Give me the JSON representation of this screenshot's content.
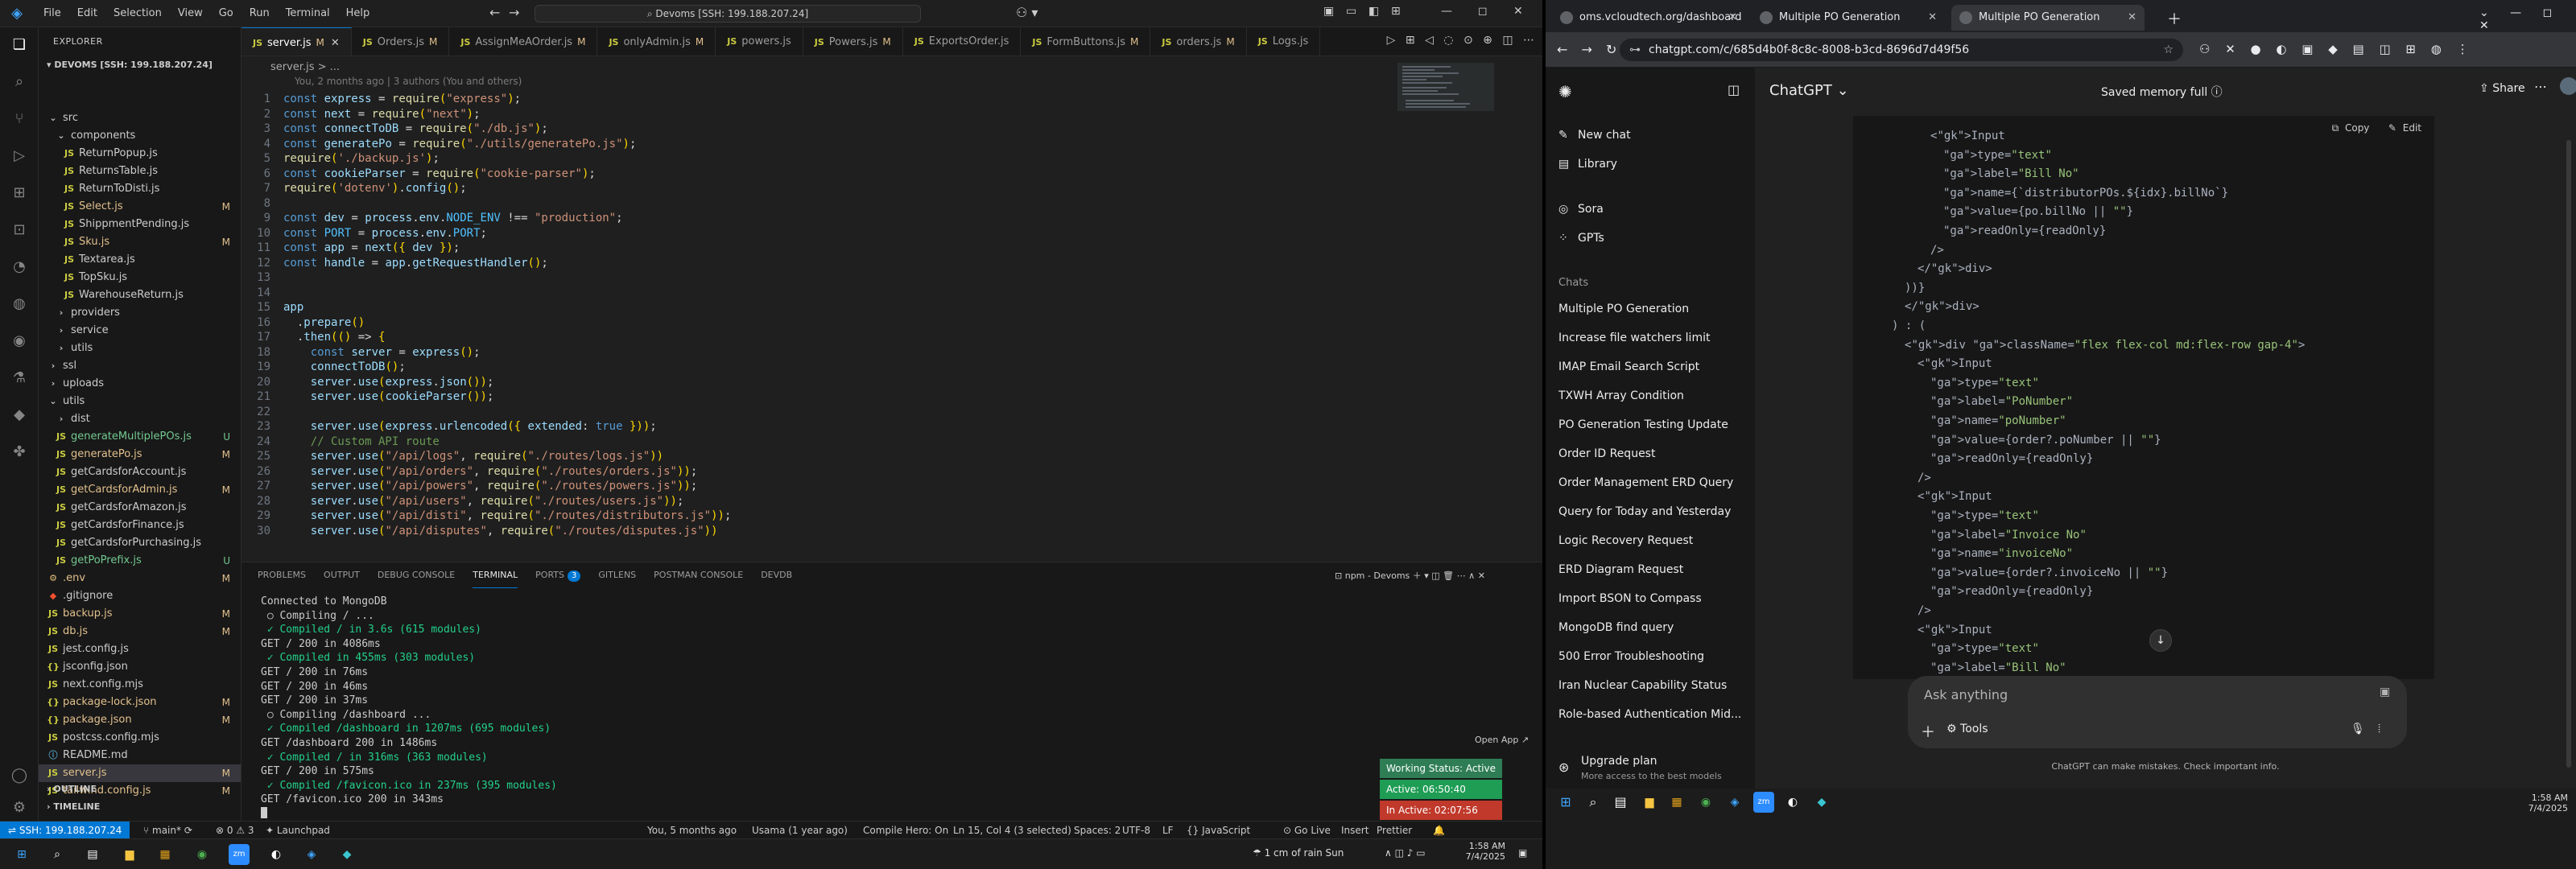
{
  "vscode": {
    "menu": [
      "File",
      "Edit",
      "Selection",
      "View",
      "Go",
      "Run",
      "Terminal",
      "Help"
    ],
    "search_text": "Devoms [SSH: 199.188.207.24]",
    "explorer_title": "EXPLORER",
    "workspace_title": "DEVOMS [SSH: 199.188.207.24]",
    "tree": [
      {
        "label": "src",
        "kind": "folder-open",
        "indent": 1,
        "badge": ""
      },
      {
        "label": "components",
        "kind": "folder-open",
        "indent": 2,
        "badge": ""
      },
      {
        "label": "ReturnPopup.js",
        "kind": "js",
        "indent": 3,
        "badge": ""
      },
      {
        "label": "ReturnsTable.js",
        "kind": "js",
        "indent": 3,
        "badge": ""
      },
      {
        "label": "ReturnToDisti.js",
        "kind": "js",
        "indent": 3,
        "badge": ""
      },
      {
        "label": "Select.js",
        "kind": "js",
        "indent": 3,
        "badge": "M"
      },
      {
        "label": "ShippmentPending.js",
        "kind": "js",
        "indent": 3,
        "badge": ""
      },
      {
        "label": "Sku.js",
        "kind": "js",
        "indent": 3,
        "badge": "M"
      },
      {
        "label": "Textarea.js",
        "kind": "js",
        "indent": 3,
        "badge": ""
      },
      {
        "label": "TopSku.js",
        "kind": "js",
        "indent": 3,
        "badge": ""
      },
      {
        "label": "WarehouseReturn.js",
        "kind": "js",
        "indent": 3,
        "badge": ""
      },
      {
        "label": "providers",
        "kind": "folder",
        "indent": 2,
        "badge": ""
      },
      {
        "label": "service",
        "kind": "folder",
        "indent": 2,
        "badge": ""
      },
      {
        "label": "utils",
        "kind": "folder",
        "indent": 2,
        "badge": ""
      },
      {
        "label": "ssl",
        "kind": "folder",
        "indent": 1,
        "badge": ""
      },
      {
        "label": "uploads",
        "kind": "folder",
        "indent": 1,
        "badge": ""
      },
      {
        "label": "utils",
        "kind": "folder-open",
        "indent": 1,
        "badge": ""
      },
      {
        "label": "dist",
        "kind": "folder",
        "indent": 2,
        "badge": ""
      },
      {
        "label": "generateMultiplePOs.js",
        "kind": "js",
        "indent": 2,
        "badge": "U"
      },
      {
        "label": "generatePo.js",
        "kind": "js",
        "indent": 2,
        "badge": "M"
      },
      {
        "label": "getCardsforAccount.js",
        "kind": "js",
        "indent": 2,
        "badge": ""
      },
      {
        "label": "getCardsforAdmin.js",
        "kind": "js",
        "indent": 2,
        "badge": "M"
      },
      {
        "label": "getCardsforAmazon.js",
        "kind": "js",
        "indent": 2,
        "badge": ""
      },
      {
        "label": "getCardsforFinance.js",
        "kind": "js",
        "indent": 2,
        "badge": ""
      },
      {
        "label": "getCardsforPurchasing.js",
        "kind": "js",
        "indent": 2,
        "badge": ""
      },
      {
        "label": "getPoPrefix.js",
        "kind": "js",
        "indent": 2,
        "badge": "U"
      },
      {
        "label": ".env",
        "kind": "env",
        "indent": 1,
        "badge": "M"
      },
      {
        "label": ".gitignore",
        "kind": "git",
        "indent": 1,
        "badge": ""
      },
      {
        "label": "backup.js",
        "kind": "js",
        "indent": 1,
        "badge": "M"
      },
      {
        "label": "db.js",
        "kind": "js",
        "indent": 1,
        "badge": "M"
      },
      {
        "label": "jest.config.js",
        "kind": "js",
        "indent": 1,
        "badge": ""
      },
      {
        "label": "jsconfig.json",
        "kind": "json",
        "indent": 1,
        "badge": ""
      },
      {
        "label": "next.config.mjs",
        "kind": "js",
        "indent": 1,
        "badge": ""
      },
      {
        "label": "package-lock.json",
        "kind": "json",
        "indent": 1,
        "badge": "M"
      },
      {
        "label": "package.json",
        "kind": "json",
        "indent": 1,
        "badge": "M"
      },
      {
        "label": "postcss.config.mjs",
        "kind": "js",
        "indent": 1,
        "badge": ""
      },
      {
        "label": "README.md",
        "kind": "md",
        "indent": 1,
        "badge": ""
      },
      {
        "label": "server.js",
        "kind": "js",
        "indent": 1,
        "badge": "M",
        "selected": true
      },
      {
        "label": "tailwind.config.js",
        "kind": "js",
        "indent": 1,
        "badge": "M"
      }
    ],
    "outline_label": "OUTLINE",
    "timeline_label": "TIMELINE",
    "tabs": [
      {
        "label": "server.js",
        "mod": "M",
        "active": true
      },
      {
        "label": "Orders.js",
        "mod": "M"
      },
      {
        "label": "AssignMeAOrder.js",
        "mod": "M"
      },
      {
        "label": "onlyAdmin.js",
        "mod": "M"
      },
      {
        "label": "powers.js",
        "mod": ""
      },
      {
        "label": "Powers.js",
        "mod": "M"
      },
      {
        "label": "ExportsOrder.js",
        "mod": ""
      },
      {
        "label": "FormButtons.js",
        "mod": "M"
      },
      {
        "label": "orders.js",
        "mod": "M"
      },
      {
        "label": "Logs.js",
        "mod": ""
      }
    ],
    "breadcrumb": "server.js > ...",
    "blame": "You, 2 months ago | 3 authors (You and others)",
    "code_lines": [
      "const express = require(\"express\");",
      "const next = require(\"next\");",
      "const connectToDB = require(\"./db.js\");",
      "const generatePo = require(\"./utils/generatePo.js\");",
      "require('./backup.js');",
      "const cookieParser = require(\"cookie-parser\");",
      "require('dotenv').config();",
      "",
      "const dev = process.env.NODE_ENV !== \"production\";",
      "const PORT = process.env.PORT;",
      "const app = next({ dev });",
      "const handle = app.getRequestHandler();",
      "",
      "",
      "app",
      "  .prepare()",
      "  .then(() => {",
      "    const server = express();",
      "    connectToDB();",
      "    server.use(express.json());",
      "    server.use(cookieParser());",
      "",
      "    server.use(express.urlencoded({ extended: true }));",
      "    // Custom API route",
      "    server.use(\"/api/logs\", require(\"./routes/logs.js\"))",
      "    server.use(\"/api/orders\", require(\"./routes/orders.js\"));",
      "    server.use(\"/api/powers\", require(\"./routes/powers.js\"));",
      "    server.use(\"/api/users\", require(\"./routes/users.js\"));",
      "    server.use(\"/api/disti\", require(\"./routes/distributors.js\"));",
      "    server.use(\"/api/disputes\", require(\"./routes/disputes.js\"))"
    ],
    "panel_tabs": [
      {
        "label": "PROBLEMS"
      },
      {
        "label": "OUTPUT"
      },
      {
        "label": "DEBUG CONSOLE"
      },
      {
        "label": "TERMINAL",
        "active": true
      },
      {
        "label": "PORTS",
        "count": "3"
      },
      {
        "label": "GITLENS"
      },
      {
        "label": "POSTMAN CONSOLE"
      },
      {
        "label": "DEVDB"
      }
    ],
    "terminal_name": "npm - Devoms",
    "terminal_lines": [
      "Connected to MongoDB",
      " ○ Compiling / ...",
      " ✓ Compiled / in 3.6s (615 modules)",
      "GET / 200 in 4086ms",
      " ✓ Compiled in 455ms (303 modules)",
      "GET / 200 in 76ms",
      "GET / 200 in 46ms",
      "GET / 200 in 37ms",
      " ○ Compiling /dashboard ...",
      " ✓ Compiled /dashboard in 1207ms (695 modules)",
      "GET /dashboard 200 in 1486ms",
      " ✓ Compiled / in 316ms (363 modules)",
      "GET / 200 in 575ms",
      " ✓ Compiled /favicon.ico in 237ms (395 modules)",
      "GET /favicon.ico 200 in 343ms"
    ],
    "wakatime": {
      "open_app": "Open App ↗",
      "status": "Working Status: Active",
      "active": "Active: 06:50:40",
      "inactive": "In Active: 02:07:56"
    },
    "status_bar": {
      "remote": "SSH: 199.188.207.24",
      "branch": "main*",
      "errors": "⊗ 0 ⚠ 3",
      "launchpad": "Launchpad",
      "blame": "You, 5 months ago",
      "user": "Usama (1 year ago)",
      "compile": "Compile Hero: On",
      "position": "Ln 15, Col 4 (3 selected)",
      "spaces": "Spaces: 2",
      "encoding": "UTF-8",
      "eol": "LF",
      "language": "{} JavaScript",
      "golive": "Go Live",
      "insert": "Insert",
      "prettier": "Prettier"
    },
    "taskbar_left": {
      "weather": "1 cm of rain Sun",
      "time": "1:58 AM",
      "date": "7/4/2025"
    }
  },
  "chrome": {
    "tabs": [
      {
        "label": "oms.vcloudtech.org/dashboard"
      },
      {
        "label": "Multiple PO Generation"
      },
      {
        "label": "Multiple PO Generation",
        "active": true
      }
    ],
    "url": "chatgpt.com/c/685d4b0f-8c8c-8008-b3cd-8696d7d49f56"
  },
  "chatgpt": {
    "side_items": [
      {
        "label": "New chat",
        "icon": "✎"
      },
      {
        "label": "Library",
        "icon": "▤"
      },
      {
        "label": "Sora",
        "icon": "◎"
      },
      {
        "label": "GPTs",
        "icon": "⁘"
      }
    ],
    "chats_label": "Chats",
    "chats": [
      "Multiple PO Generation",
      "Increase file watchers limit",
      "IMAP Email Search Script",
      "TXWH Array Condition",
      "PO Generation Testing Update",
      "Order ID Request",
      "Order Management ERD Query",
      "Query for Today and Yesterday",
      "Logic Recovery Request",
      "ERD Diagram Request",
      "Import BSON to Compass",
      "MongoDB find query",
      "500 Error Troubleshooting",
      "Iran Nuclear Capability Status",
      "Role-based Authentication Mid..."
    ],
    "upgrade_title": "Upgrade plan",
    "upgrade_sub": "More access to the best models",
    "model": "ChatGPT",
    "memory": "Saved memory full",
    "share": "Share",
    "copy": "Copy",
    "edit": "Edit",
    "code": [
      {
        "indent": 1,
        "text": "<Input"
      },
      {
        "indent": 2,
        "text": "type=\"text\""
      },
      {
        "indent": 2,
        "text": "label=\"Bill No\""
      },
      {
        "indent": 2,
        "text": "name={`distributorPOs.${idx}.billNo`}"
      },
      {
        "indent": 2,
        "text": "value={po.billNo || \"\"}"
      },
      {
        "indent": 2,
        "text": "readOnly={readOnly}"
      },
      {
        "indent": 1,
        "text": "/>"
      },
      {
        "indent": 0,
        "text": "</div>"
      },
      {
        "indent": -1,
        "text": "))}"
      },
      {
        "indent": -1,
        "text": "</div>"
      },
      {
        "indent": -2,
        "text": ") : ("
      },
      {
        "indent": -1,
        "text": "<div className=\"flex flex-col md:flex-row gap-4\">"
      },
      {
        "indent": 0,
        "text": "<Input"
      },
      {
        "indent": 1,
        "text": "type=\"text\""
      },
      {
        "indent": 1,
        "text": "label=\"PoNumber\""
      },
      {
        "indent": 1,
        "text": "name=\"poNumber\""
      },
      {
        "indent": 1,
        "text": "value={order?.poNumber || \"\"}"
      },
      {
        "indent": 1,
        "text": "readOnly={readOnly}"
      },
      {
        "indent": 0,
        "text": "/>"
      },
      {
        "indent": 0,
        "text": "<Input"
      },
      {
        "indent": 1,
        "text": "type=\"text\""
      },
      {
        "indent": 1,
        "text": "label=\"Invoice No\""
      },
      {
        "indent": 1,
        "text": "name=\"invoiceNo\""
      },
      {
        "indent": 1,
        "text": "value={order?.invoiceNo || \"\"}"
      },
      {
        "indent": 1,
        "text": "readOnly={readOnly}"
      },
      {
        "indent": 0,
        "text": "/>"
      },
      {
        "indent": 0,
        "text": "<Input"
      },
      {
        "indent": 1,
        "text": "type=\"text\""
      },
      {
        "indent": 1,
        "text": "label=\"Bill No\""
      }
    ],
    "ask_placeholder": "Ask anything",
    "tools": "Tools",
    "disclaimer": "ChatGPT can make mistakes. Check important info."
  },
  "taskbar_right": {
    "time": "1:58 AM",
    "date": "7/4/2025"
  }
}
